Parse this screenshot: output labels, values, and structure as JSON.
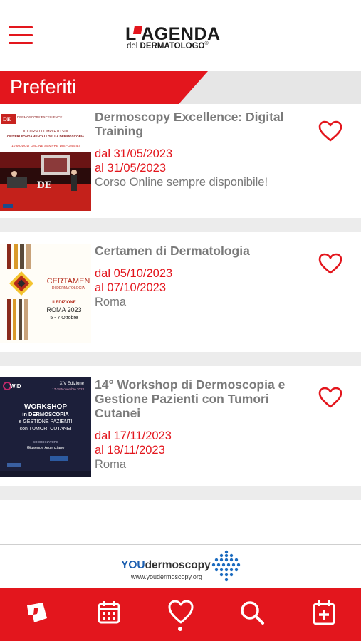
{
  "header": {
    "logo_top": "L'AGENDA",
    "logo_bottom_prefix": "del ",
    "logo_bottom_strong": "DERMATOLOGO",
    "logo_mark": "®"
  },
  "section": {
    "title": "Preferiti"
  },
  "events": [
    {
      "title": "Dermoscopy Excellence: Digital Training",
      "date_from": "dal 31/05/2023",
      "date_to": "al 31/05/2023",
      "place": "Corso Online sempre disponibile!",
      "thumb": {
        "brand": "DERMOSCOPY EXCELLENCE",
        "line1": "IL CORSO COMPLETO SUI",
        "line2": "CRITERI FONDAMENTALI DELLA DERMOSCOPIA",
        "line3": "10 MODULI ONLINE SEMPRE DISPONIBILI",
        "mark": "DE"
      }
    },
    {
      "title": "Certamen di Dermatologia",
      "date_from": "dal 05/10/2023",
      "date_to": "al 07/10/2023",
      "place": "Roma",
      "thumb": {
        "name1": "CERTAMEN",
        "name2": "DI DERMATOLOGIA",
        "edition": "II EDIZIONE",
        "city": "ROMA 2023",
        "dates": "5 - 7 Ottobre"
      }
    },
    {
      "title": "14° Workshop di Dermoscopia e Gestione Pazienti con Tumori Cutanei",
      "date_from": "dal 17/11/2023",
      "date_to": "al 18/11/2023",
      "place": "Roma",
      "thumb": {
        "logo": "WID",
        "edition": "XIV Edizione",
        "dates": "17-18 Novembre 2023",
        "word": "WORKSHOP",
        "line1": "in DERMOSCOPIA",
        "line2": "e GESTIONE PAZIENTI",
        "line3": "con TUMORI CUTANEI",
        "coord_label": "COORDINATORE",
        "coord_name": "Giuseppe Argenziano"
      }
    }
  ],
  "sponsor": {
    "name_prefix": "YOU",
    "name_suffix": "dermoscopy",
    "url": "www.youdermoscopy.org"
  },
  "tabbar": {
    "tabs": [
      "agenda-logo-icon",
      "calendar-icon",
      "heart-icon",
      "search-icon",
      "calendar-add-icon"
    ],
    "active": "heart-icon",
    "accent": "#e3161d"
  }
}
